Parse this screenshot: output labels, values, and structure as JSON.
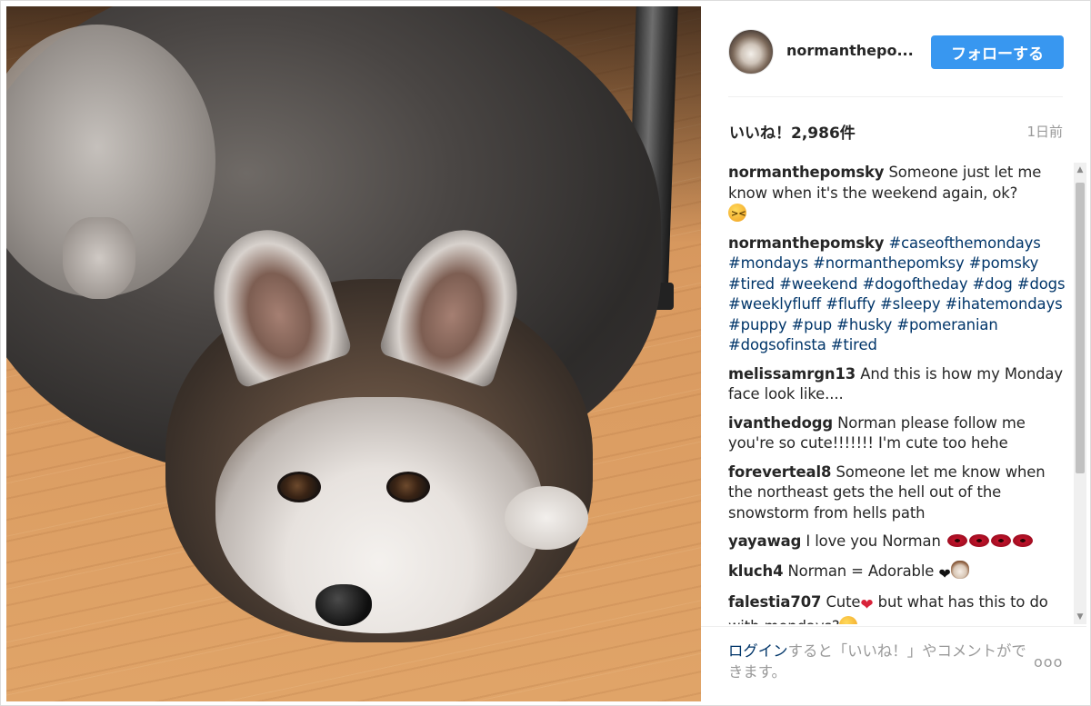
{
  "header": {
    "username": "normanthepo...",
    "follow_label": "フォローする"
  },
  "meta": {
    "likes": "いいね！2,986件",
    "time_ago": "1日前"
  },
  "comments": [
    {
      "user": "normanthepomsky",
      "text": "Someone just let me know when it's the weekend again, ok?"
    },
    {
      "user": "normanthepomsky",
      "tags": "#caseofthemondays #mondays #normanthepomksy #pomsky #tired #weekend #dogoftheday #dog #dogs #weeklyfluff #fluffy #sleepy #ihatemondays #puppy #pup #husky #pomeranian #dogsofinsta #tired"
    },
    {
      "user": "melissamrgn13",
      "text": "And this is how my Monday face look like...."
    },
    {
      "user": "ivanthedogg",
      "text": "Norman please follow me you're so cute!!!!!!! I'm cute too hehe"
    },
    {
      "user": "foreverteal8",
      "text": "Someone let me know when the northeast gets the hell out of the snowstorm from hells path"
    },
    {
      "user": "yayawag",
      "text": "I love you Norman"
    },
    {
      "user": "kluch4",
      "text": "Norman = Adorable"
    },
    {
      "user": "falestia707",
      "text_a": "Cute",
      "text_b": "but what has this to do with mondays?"
    }
  ],
  "footer": {
    "login_link": "ログイン",
    "login_rest": "すると「いいね！」やコメントができます。",
    "more_label": "ooo"
  },
  "icons": {
    "emoji_1": "tired-face",
    "emoji_2": "kiss-lips",
    "emoji_3": "black-heart",
    "emoji_4": "dog-face",
    "emoji_5": "red-heart",
    "emoji_6": "tears-of-joy"
  },
  "colors": {
    "accent": "#3897f0",
    "link": "#003569",
    "muted": "#999999"
  }
}
